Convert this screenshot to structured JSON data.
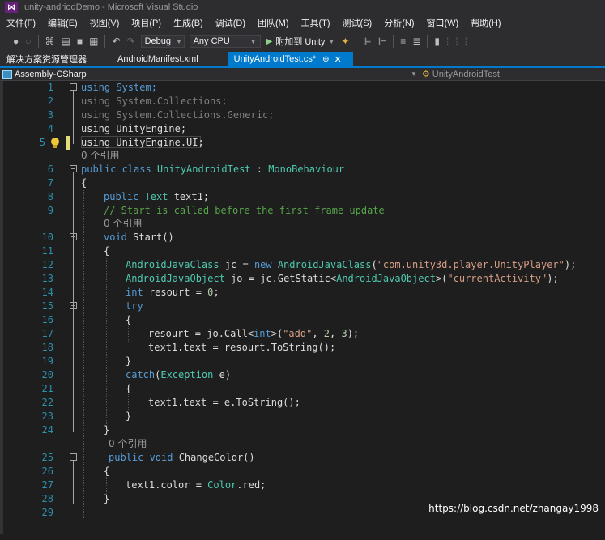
{
  "window": {
    "title": "unity-andriodDemo - Microsoft Visual Studio",
    "logo": "vs-logo"
  },
  "menu": [
    "文件(F)",
    "编辑(E)",
    "视图(V)",
    "项目(P)",
    "生成(B)",
    "调试(D)",
    "团队(M)",
    "工具(T)",
    "测试(S)",
    "分析(N)",
    "窗口(W)",
    "帮助(H)"
  ],
  "toolbar": {
    "config": "Debug",
    "platform": "Any CPU",
    "attach_label": "附加到 Unity"
  },
  "tabs": [
    {
      "label": "解决方案资源管理器",
      "active": false
    },
    {
      "label": "AndroidManifest.xml",
      "active": false
    },
    {
      "label": "UnityAndroidTest.cs*",
      "active": true
    }
  ],
  "navbar": {
    "project": "Assembly-CSharp",
    "class": "UnityAndroidTest"
  },
  "refs_label": "0 个引用",
  "line_numbers": [
    "1",
    "2",
    "3",
    "4",
    "5",
    "6",
    "7",
    "8",
    "9",
    "10",
    "11",
    "12",
    "13",
    "14",
    "15",
    "16",
    "17",
    "18",
    "19",
    "20",
    "21",
    "22",
    "23",
    "24",
    "25",
    "26",
    "27",
    "28",
    "29"
  ],
  "code": {
    "l1": "using System;",
    "l2": "using System.Collections;",
    "l3": "using System.Collections.Generic;",
    "l4": "using UnityEngine;",
    "l5": "using UnityEngine.UI;",
    "l6": "public class UnityAndroidTest : MonoBehaviour",
    "l7": "{",
    "l8": "public Text text1;",
    "l9": "// Start is called before the first frame update",
    "l10": "void Start()",
    "l11": "{",
    "l12": "AndroidJavaClass jc = new AndroidJavaClass(\"com.unity3d.player.UnityPlayer\");",
    "l13": "AndroidJavaObject jo = jc.GetStatic<AndroidJavaObject>(\"currentActivity\");",
    "l14": "int resourt = 0;",
    "l15": "try",
    "l16": "{",
    "l17": "resourt = jo.Call<int>(\"add\", 2, 3);",
    "l18": "text1.text = resourt.ToString();",
    "l19": "}",
    "l20": "catch(Exception e)",
    "l21": "{",
    "l22": "text1.text = e.ToString();",
    "l23": "}",
    "l24": "}",
    "l25": "public void ChangeColor()",
    "l26": "{",
    "l27": "text1.color = Color.red;",
    "l28": "}"
  },
  "watermark": "https://blog.csdn.net/zhangay1998",
  "colors": {
    "keyword": "#569cd6",
    "type": "#4ec9b0",
    "string": "#d69d85",
    "comment": "#57a64a",
    "line_number": "#2b91af",
    "accent": "#007acc"
  }
}
